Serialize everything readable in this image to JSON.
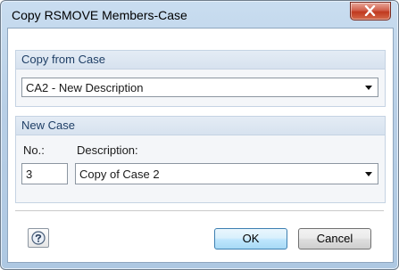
{
  "window": {
    "title": "Copy RSMOVE Members-Case"
  },
  "copy_from": {
    "header": "Copy from Case",
    "selected": "CA2 - New Description"
  },
  "new_case": {
    "header": "New Case",
    "no_label": "No.:",
    "no_value": "3",
    "description_label": "Description:",
    "description_value": "Copy of Case 2"
  },
  "buttons": {
    "ok": "OK",
    "cancel": "Cancel"
  },
  "icons": {
    "close": "close-icon",
    "help": "help-icon",
    "dropdown": "chevron-down-icon"
  },
  "colors": {
    "title_bar": "#b8cfe6",
    "close_button": "#c0391f",
    "group_header_text": "#1f3f66",
    "default_button_border": "#3c7fb1"
  }
}
